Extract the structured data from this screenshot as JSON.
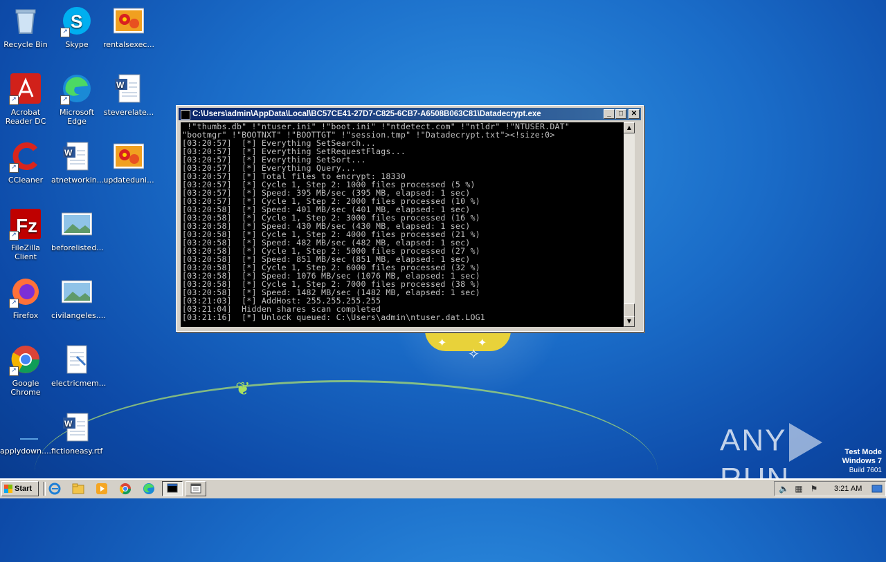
{
  "desktop": {
    "icons": [
      {
        "label": "Recycle Bin"
      },
      {
        "label": "Skype"
      },
      {
        "label": "rentalsexec..."
      },
      {
        "label": "Acrobat Reader DC"
      },
      {
        "label": "Microsoft Edge"
      },
      {
        "label": "steverelate..."
      },
      {
        "label": "CCleaner"
      },
      {
        "label": "atnetworkin..."
      },
      {
        "label": "updateduni..."
      },
      {
        "label": "FileZilla Client"
      },
      {
        "label": "beforelisted..."
      },
      {
        "label": "Firefox"
      },
      {
        "label": "civilangeles...."
      },
      {
        "label": "Google Chrome"
      },
      {
        "label": "electricmem..."
      },
      {
        "label": "applydown...."
      },
      {
        "label": "fictioneasy.rtf"
      }
    ]
  },
  "window": {
    "title": "C:\\Users\\admin\\AppData\\Local\\BC57CE41-27D7-C825-6CB7-A6508B063C81\\Datadecrypt.exe",
    "lines": [
      " !\"thumbs.db\" !\"ntuser.ini\" !\"boot.ini\" !\"ntdetect.com\" !\"ntldr\" !\"NTUSER.DAT\"",
      "\"bootmgr\" !\"BOOTNXT\" !\"BOOTTGT\" !\"session.tmp\" !\"Datadecrypt.txt\"><!size:0>",
      "[03:20:57]  [*] Everything SetSearch...",
      "[03:20:57]  [*] Everything SetRequestFlags...",
      "[03:20:57]  [*] Everything SetSort...",
      "[03:20:57]  [*] Everything Query...",
      "[03:20:57]  [*] Total files to encrypt: 18330",
      "[03:20:57]  [*] Cycle 1, Step 2: 1000 files processed (5 %)",
      "[03:20:57]  [*] Speed: 395 MB/sec (395 MB, elapsed: 1 sec)",
      "[03:20:57]  [*] Cycle 1, Step 2: 2000 files processed (10 %)",
      "[03:20:58]  [*] Speed: 401 MB/sec (401 MB, elapsed: 1 sec)",
      "[03:20:58]  [*] Cycle 1, Step 2: 3000 files processed (16 %)",
      "[03:20:58]  [*] Speed: 430 MB/sec (430 MB, elapsed: 1 sec)",
      "[03:20:58]  [*] Cycle 1, Step 2: 4000 files processed (21 %)",
      "[03:20:58]  [*] Speed: 482 MB/sec (482 MB, elapsed: 1 sec)",
      "[03:20:58]  [*] Cycle 1, Step 2: 5000 files processed (27 %)",
      "[03:20:58]  [*] Speed: 851 MB/sec (851 MB, elapsed: 1 sec)",
      "[03:20:58]  [*] Cycle 1, Step 2: 6000 files processed (32 %)",
      "[03:20:58]  [*] Speed: 1076 MB/sec (1076 MB, elapsed: 1 sec)",
      "[03:20:58]  [*] Cycle 1, Step 2: 7000 files processed (38 %)",
      "[03:20:58]  [*] Speed: 1482 MB/sec (1482 MB, elapsed: 1 sec)",
      "[03:21:03]  [*] AddHost: 255.255.255.255",
      "[03:21:04]  Hidden shares scan completed",
      "[03:21:16]  [*] Unlock queued: C:\\Users\\admin\\ntuser.dat.LOG1"
    ]
  },
  "watermark": {
    "brand_left": "ANY",
    "brand_right": "RUN",
    "test_mode": "Test Mode",
    "os": "Windows 7",
    "build": "Build 7601"
  },
  "taskbar": {
    "start_label": "Start",
    "clock": "3:21 AM"
  }
}
